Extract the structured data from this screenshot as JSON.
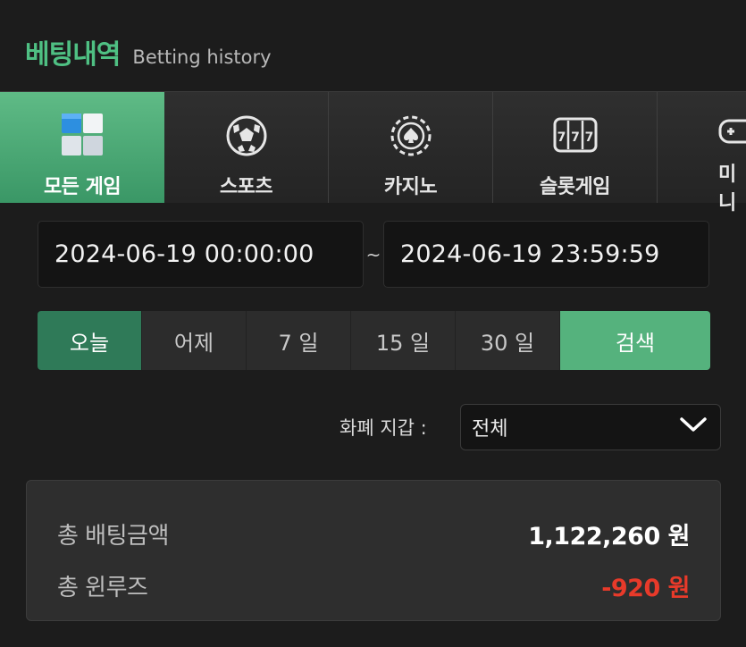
{
  "header": {
    "title_ko": "베팅내역",
    "title_en": "Betting history"
  },
  "tabs": [
    {
      "label": "모든 게임",
      "icon": "cube-blocks-icon",
      "active": true
    },
    {
      "label": "스포츠",
      "icon": "soccer-ball-icon",
      "active": false
    },
    {
      "label": "카지노",
      "icon": "casino-chip-icon",
      "active": false
    },
    {
      "label": "슬롯게임",
      "icon": "slot-machine-icon",
      "active": false
    },
    {
      "label": "미니",
      "icon": "gamepad-icon",
      "active": false
    }
  ],
  "date_range": {
    "start": "2024-06-19 00:00:00",
    "separator": "~",
    "end": "2024-06-19 23:59:59"
  },
  "quick_filters": [
    {
      "label": "오늘",
      "active": true
    },
    {
      "label": "어제",
      "active": false
    },
    {
      "label": "7 일",
      "active": false
    },
    {
      "label": "15 일",
      "active": false
    },
    {
      "label": "30 일",
      "active": false
    }
  ],
  "search_label": "검색",
  "currency": {
    "label": "화폐 지갑 :",
    "selected": "전체"
  },
  "summary": {
    "total_bet_label": "총 배팅금액",
    "total_bet_value": "1,122,260 원",
    "total_winloss_label": "총 윈루즈",
    "total_winloss_value": "-920 원"
  },
  "colors": {
    "accent": "#4fc083",
    "active_tab": "#4aa972",
    "negative": "#e83a2a",
    "background": "#1c1c1c"
  }
}
